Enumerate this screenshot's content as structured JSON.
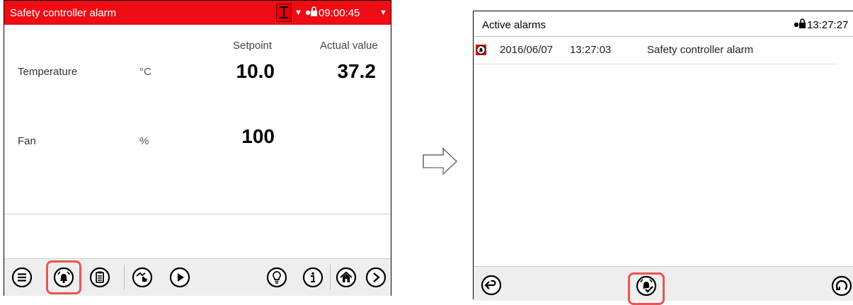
{
  "left_screen": {
    "header": {
      "title": "Safety controller alarm",
      "time": "09:00:45",
      "background": "#ee0d15"
    },
    "columns": {
      "setpoint": "Setpoint",
      "actual": "Actual value"
    },
    "rows": [
      {
        "label": "Temperature",
        "unit": "°C",
        "setpoint": "10.0",
        "actual": "37.2"
      },
      {
        "label": "Fan",
        "unit": "%",
        "setpoint": "100",
        "actual": ""
      }
    ],
    "toolbar": {
      "icons": [
        "menu-icon",
        "alarm-bell-icon",
        "clipboard-icon",
        "manual-mode-icon",
        "play-icon",
        "light-bulb-icon",
        "info-icon",
        "home-icon",
        "next-icon"
      ],
      "highlighted": "alarm-bell-icon"
    }
  },
  "right_screen": {
    "header": {
      "title": "Active alarms",
      "time": "13:27:27"
    },
    "alarms": [
      {
        "date": "2016/06/07",
        "time": "13:27:03",
        "message": "Safety controller alarm"
      }
    ],
    "toolbar": {
      "icons": [
        "back-icon",
        "alarm-acknowledge-icon",
        "refresh-icon"
      ],
      "highlighted": "alarm-acknowledge-icon"
    }
  },
  "colors": {
    "alarm_red": "#e3000b",
    "highlight": "#e85555",
    "toolbar_bg": "#eeeeee"
  }
}
